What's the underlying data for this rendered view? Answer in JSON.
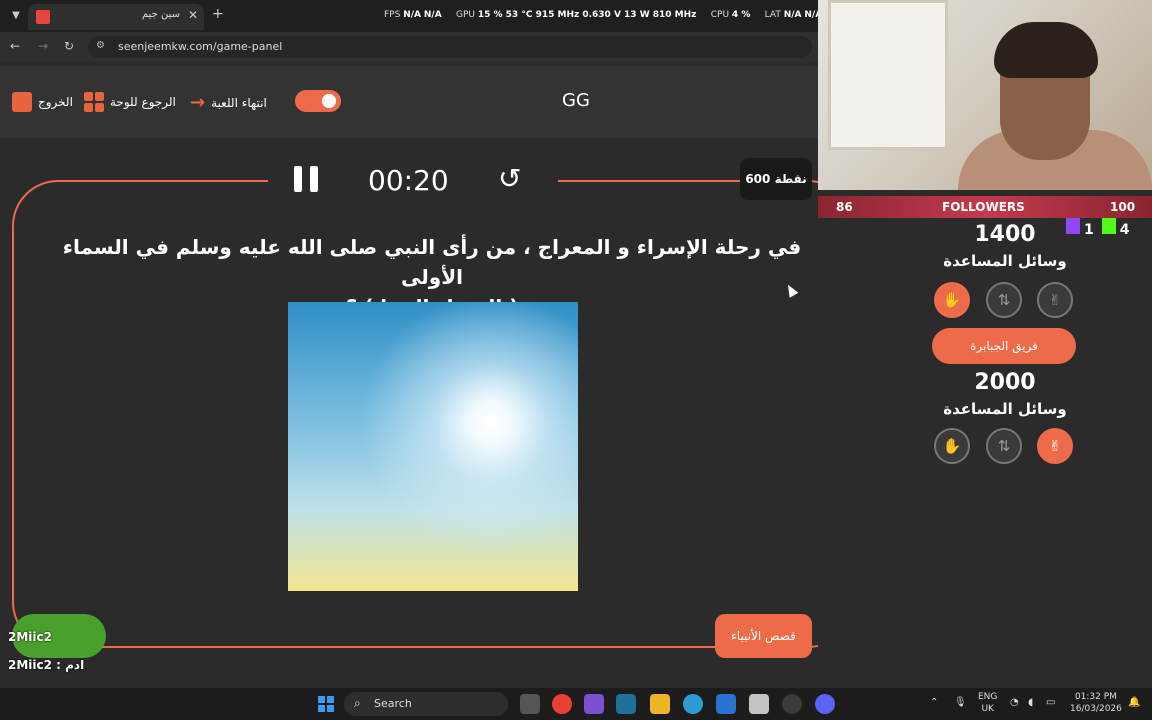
{
  "browser": {
    "tab_title": "سين جيم",
    "url": "seenjeemkw.com/game-panel",
    "perf": {
      "fps_label": "FPS",
      "fps_value": "N/A",
      "fps_value2": "N/A",
      "gpu_label": "GPU",
      "gpu_value": "15 % 53 °C 915 MHz 0.630 V 13 W 810 MHz",
      "cpu_label": "CPU",
      "cpu_value": "4 %",
      "lat_label": "LAT",
      "lat_value": "N/A",
      "lat_value2": "N/A"
    }
  },
  "header": {
    "exit_label": "الخروج",
    "board_label": "الرجوع للوحة",
    "end_game_label": "انتهاء اللعبة",
    "team_name": "GG"
  },
  "game": {
    "timer": "00:20",
    "points_badge": "600 نقطة",
    "question_line1": "في رحلة الإسراء و المعراج ، من رأى النبي صلى الله عليه وسلم في السماء الأولى",
    "question_line2": "( السماء الدنيا ) ؟",
    "category": "قصص الأنبياء"
  },
  "chat": {
    "line1": "2Miic2",
    "line2": "2Miic2 : ادم"
  },
  "stream_bar": {
    "left_count": "86",
    "label": "FOLLOWERS",
    "right_count": "100",
    "twitch_count": "1",
    "kick_count": "4"
  },
  "teams": [
    {
      "score": "1400",
      "aids_label": "وسائل المساعدة"
    },
    {
      "name": "فريق الجبابرة",
      "score": "2000",
      "aids_label": "وسائل المساعدة"
    }
  ],
  "taskbar": {
    "search_placeholder": "Search",
    "lang_top": "ENG",
    "lang_bottom": "UK",
    "time": "01:32 PM",
    "date": "16/03/2026"
  },
  "colors": {
    "accent": "#ee6b4a",
    "background": "#2b2b2b",
    "followers_bar": "#c43a4d"
  }
}
